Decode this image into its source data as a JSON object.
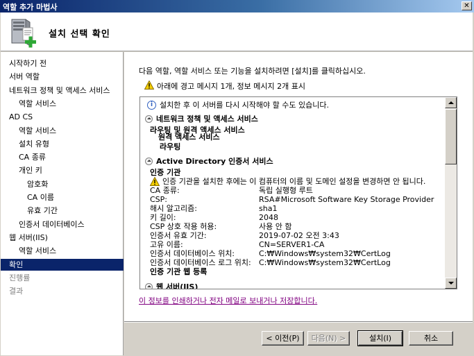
{
  "window": {
    "title": "역할 추가 마법사",
    "close_label": "✕"
  },
  "header": {
    "heading": "설치 선택 확인",
    "icon": "server-add-icon"
  },
  "nav": {
    "items": [
      {
        "label": "시작하기 전",
        "indent": 0,
        "state": "normal"
      },
      {
        "label": "서버 역할",
        "indent": 0,
        "state": "normal"
      },
      {
        "label": "네트워크 정책 및 액세스 서비스",
        "indent": 0,
        "state": "normal"
      },
      {
        "label": "역할 서비스",
        "indent": 1,
        "state": "normal"
      },
      {
        "label": "AD CS",
        "indent": 0,
        "state": "normal"
      },
      {
        "label": "역할 서비스",
        "indent": 1,
        "state": "normal"
      },
      {
        "label": "설치 유형",
        "indent": 1,
        "state": "normal"
      },
      {
        "label": "CA 종류",
        "indent": 1,
        "state": "normal"
      },
      {
        "label": "개인 키",
        "indent": 1,
        "state": "normal"
      },
      {
        "label": "암호화",
        "indent": 2,
        "state": "normal"
      },
      {
        "label": "CA 이름",
        "indent": 2,
        "state": "normal"
      },
      {
        "label": "유효 기간",
        "indent": 2,
        "state": "normal"
      },
      {
        "label": "인증서 데이터베이스",
        "indent": 1,
        "state": "normal"
      },
      {
        "label": "웹 서버(IIS)",
        "indent": 0,
        "state": "normal"
      },
      {
        "label": "역할 서비스",
        "indent": 1,
        "state": "normal"
      },
      {
        "label": "확인",
        "indent": 0,
        "state": "active"
      },
      {
        "label": "진행률",
        "indent": 0,
        "state": "disabled"
      },
      {
        "label": "결과",
        "indent": 0,
        "state": "disabled"
      }
    ]
  },
  "main": {
    "intro": "다음 역할, 역할 서비스 또는 기능을 설치하려면 [설치]를 클릭하십시오.",
    "warning_summary": "아래에 경고 메시지 1개, 정보 메시지 2개 표시",
    "results": {
      "restart_info": "설치한 후 이 서버를 다시 시작해야 할 수도 있습니다.",
      "npas": {
        "header": "네트워크 정책 및 액세스 서비스",
        "lines": [
          "라우팅 및 원격 액세스 서비스",
          "원격 액세스 서비스",
          "라우팅"
        ]
      },
      "adcs": {
        "header": "Active Directory 인증서 서비스",
        "ca_title": "인증 기관",
        "warning": "인증 기관을 설치한 후에는 이 컴퓨터의 이름 및 도메인 설정을 변경하면 안 됩니다.",
        "props": [
          {
            "k": "CA 종류:",
            "v": "독립 실행형 루트"
          },
          {
            "k": "CSP:",
            "v": "RSA#Microsoft Software Key Storage Provider"
          },
          {
            "k": "해시 알고리즘:",
            "v": "sha1"
          },
          {
            "k": "키 길이:",
            "v": "2048"
          },
          {
            "k": "CSP 상호 작용 허용:",
            "v": "사용 안 함"
          },
          {
            "k": "인증서 유효 기간:",
            "v": "2019-07-02 오전 3:43"
          },
          {
            "k": "고유 이름:",
            "v": "CN=SERVER1-CA"
          },
          {
            "k": "인증서 데이터베이스 위치:",
            "v": "C:₩Windows₩system32₩CertLog"
          },
          {
            "k": "인증서 데이터베이스 로그 위치:",
            "v": "C:₩Windows₩system32₩CertLog"
          }
        ],
        "web_enroll": "인증 기관 웹 등록"
      },
      "iis_header": "웹 서버(IIS)"
    },
    "link": "이 정보를 인쇄하거나 전자 메일로 보내거나 저장합니다."
  },
  "buttons": {
    "prev": "< 이전(P)",
    "next": "다음(N) >",
    "install": "설치(I)",
    "cancel": "취소"
  },
  "colors": {
    "selection": "#0a246a",
    "link": "#800080",
    "dialog": "#d4d0c8"
  }
}
